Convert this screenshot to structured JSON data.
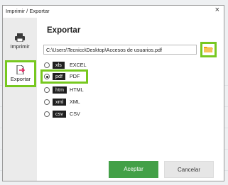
{
  "window": {
    "title": "Imprimir / Exportar",
    "close_glyph": "×"
  },
  "sidebar": {
    "items": [
      {
        "label": "Imprimir",
        "icon": "printer-icon",
        "selected": false
      },
      {
        "label": "Exportar",
        "icon": "export-document-icon",
        "selected": true
      }
    ]
  },
  "main": {
    "heading": "Exportar",
    "path_value": "C:\\Users\\Tecnico\\Desktop\\Accesos de usuarios.pdf",
    "browse_icon": "folder-icon",
    "formats": [
      {
        "tag": "xls",
        "label": "EXCEL",
        "selected": false
      },
      {
        "tag": "pdf",
        "label": "PDF",
        "selected": true
      },
      {
        "tag": "htm",
        "label": "HTML",
        "selected": false
      },
      {
        "tag": "xml",
        "label": "XML",
        "selected": false
      },
      {
        "tag": "csv",
        "label": "CSV",
        "selected": false
      }
    ]
  },
  "buttons": {
    "accept": "Aceptar",
    "cancel": "Cancelar"
  },
  "colors": {
    "highlight": "#77c81f",
    "accept_bg": "#43a047",
    "tag_bg": "#1f1f1f"
  }
}
